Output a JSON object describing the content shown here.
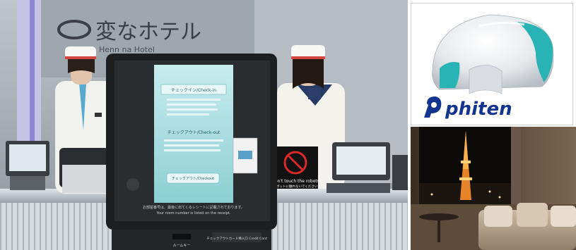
{
  "hotel_scene": {
    "sign_jp": "変なホテル",
    "sign_en": "Henn na Hotel",
    "kiosk": {
      "checkin": "チェックイン/Check-in",
      "checkout": "チェックアウト/Check-out",
      "button": "チェックアウト/Checkout",
      "footer_jp": "お部屋番号は、最後に出てくるレシートに記載されております。",
      "footer_en": "Your room number is listed on the receipt.",
      "slot_label": "ルームキー",
      "card_slot": "チェックアウトカード挿入口 Credit Card"
    },
    "warning_sign": {
      "line1": "Don't touch the robots",
      "line2": "ロボットに触れないでください"
    }
  },
  "product_ad": {
    "brand": "phiten"
  },
  "colors": {
    "screen": "#b7e2e4",
    "brand_blue": "#14358f",
    "teal": "#2ab3b4"
  }
}
